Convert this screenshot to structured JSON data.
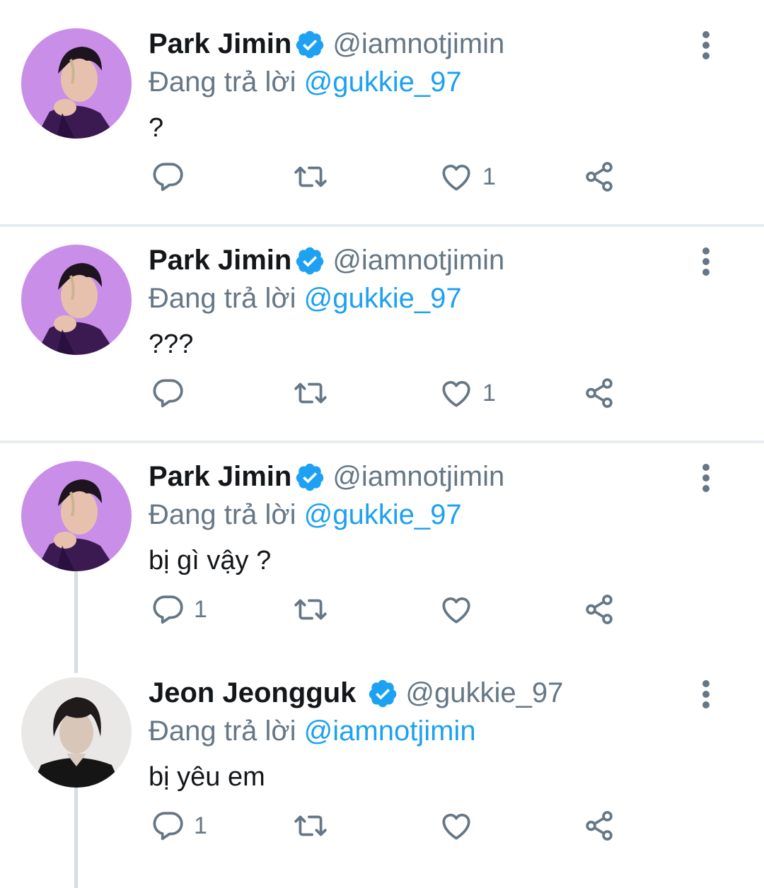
{
  "colors": {
    "accent": "#1da1f2",
    "muted": "#657786",
    "text": "#14171a",
    "divider": "#e6ecf0"
  },
  "tweets": [
    {
      "name": "Park Jimin",
      "handle": "@iamnotjimin",
      "reply_prefix": "Đang trả lời",
      "reply_to": "@gukkie_97",
      "text": "?",
      "reply_count": "",
      "retweet_count": "",
      "like_count": "1",
      "avatar_icon": "avatar-purple-portrait",
      "verified": true
    },
    {
      "name": "Park Jimin",
      "handle": "@iamnotjimin",
      "reply_prefix": "Đang trả lời",
      "reply_to": "@gukkie_97",
      "text": "???",
      "reply_count": "",
      "retweet_count": "",
      "like_count": "1",
      "avatar_icon": "avatar-purple-portrait",
      "verified": true
    },
    {
      "name": "Park Jimin",
      "handle": "@iamnotjimin",
      "reply_prefix": "Đang trả lời",
      "reply_to": "@gukkie_97",
      "text": "bị gì vậy ?",
      "reply_count": "1",
      "retweet_count": "",
      "like_count": "",
      "avatar_icon": "avatar-purple-portrait",
      "verified": true
    },
    {
      "name": "Jeon Jeongguk",
      "handle": "@gukkie_97",
      "reply_prefix": "Đang trả lời",
      "reply_to": "@iamnotjimin",
      "text": "bị yêu em",
      "reply_count": "1",
      "retweet_count": "",
      "like_count": "",
      "avatar_icon": "avatar-grey-portrait",
      "verified": true
    }
  ]
}
